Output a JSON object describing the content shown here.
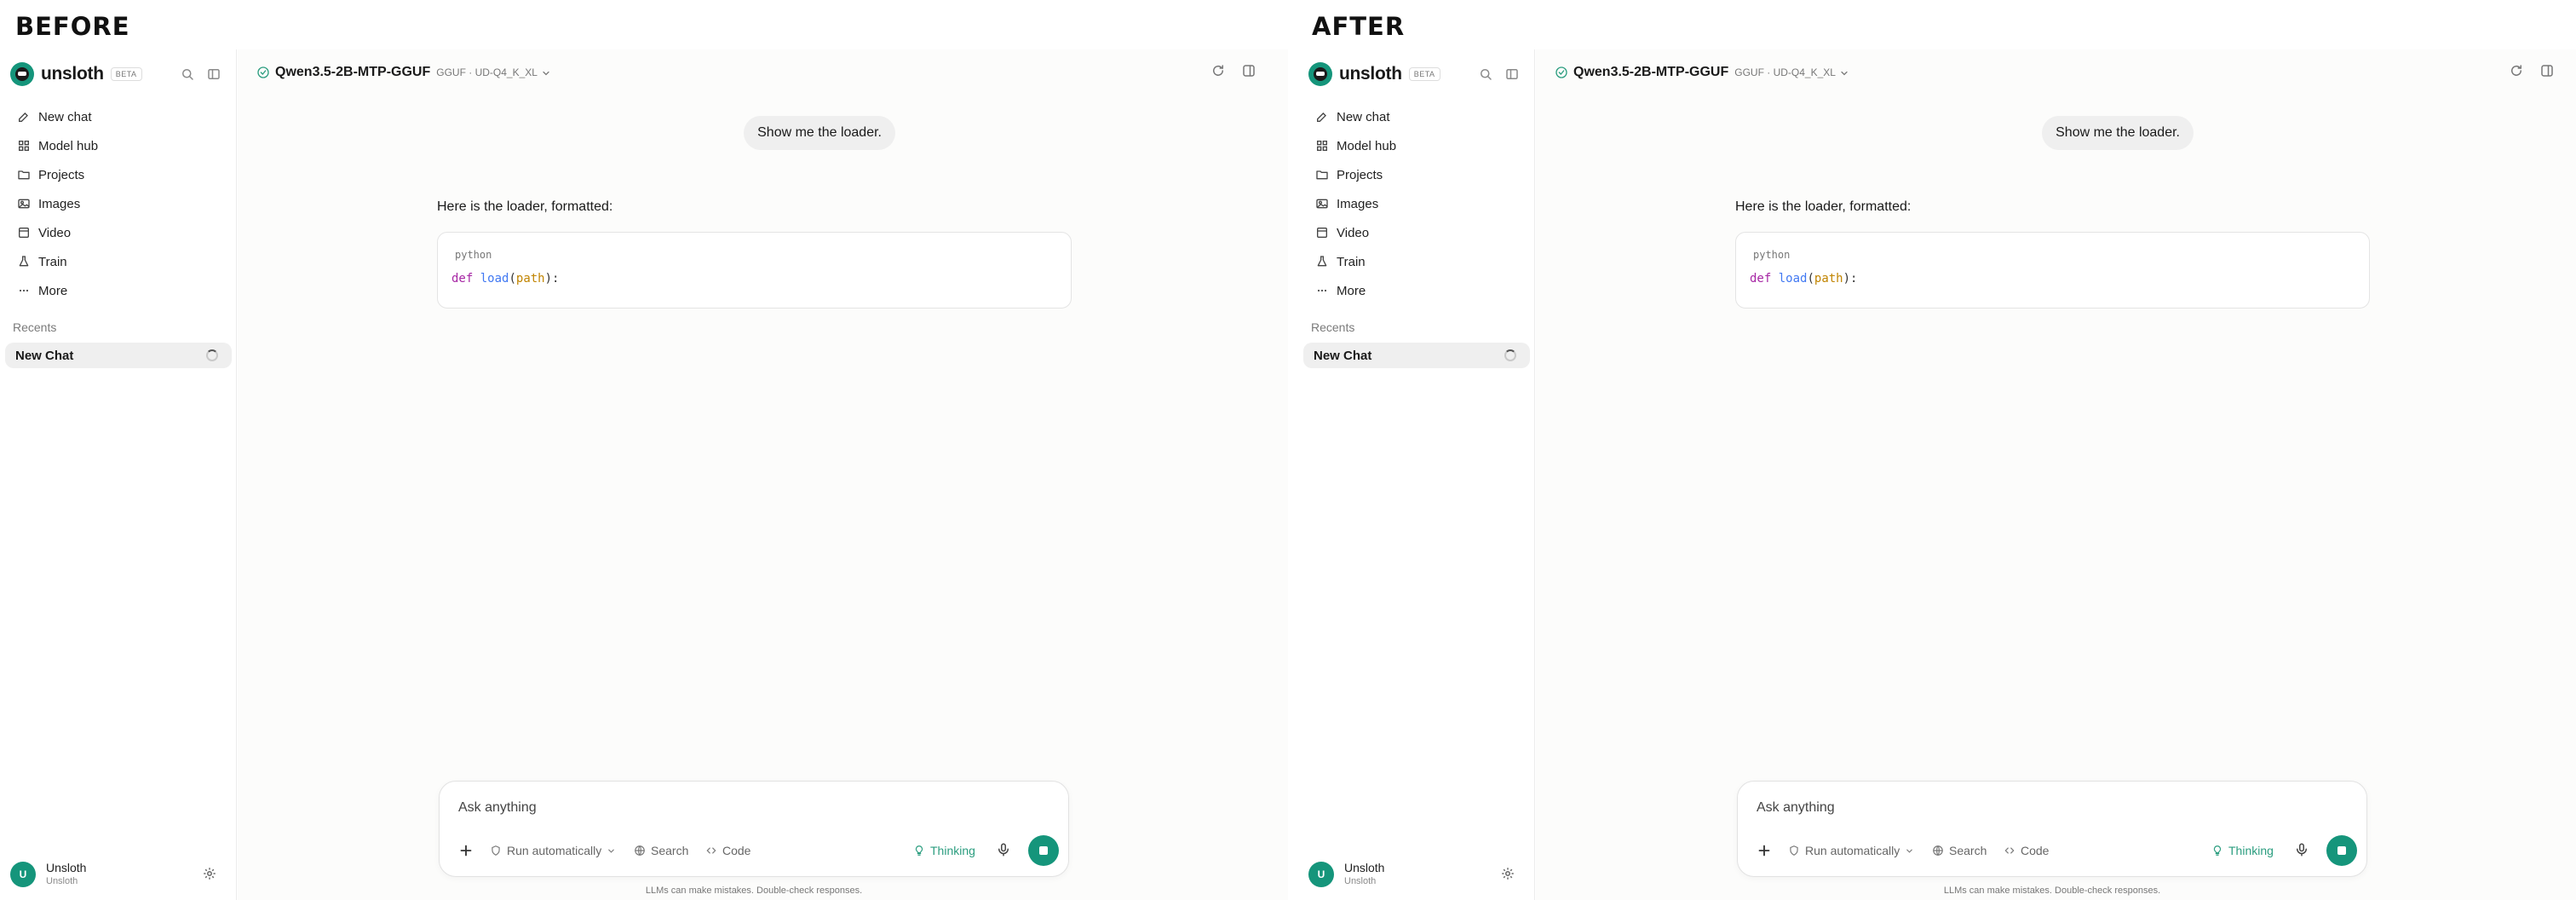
{
  "labels": {
    "before": "BEFORE",
    "after": "AFTER"
  },
  "app": {
    "brand_name": "unsloth",
    "brand_badge": "BETA"
  },
  "sidebar": {
    "nav": [
      {
        "label": "New chat",
        "icon": "edit-icon"
      },
      {
        "label": "Model hub",
        "icon": "grid-icon"
      },
      {
        "label": "Projects",
        "icon": "folder-icon"
      },
      {
        "label": "Images",
        "icon": "image-icon"
      },
      {
        "label": "Video",
        "icon": "video-icon"
      },
      {
        "label": "Train",
        "icon": "flask-icon"
      },
      {
        "label": "More",
        "icon": "ellipsis-icon"
      }
    ],
    "recents_label": "Recents",
    "recents": [
      {
        "label": "New Chat"
      }
    ]
  },
  "user": {
    "initial": "U",
    "name": "Unsloth",
    "subtitle": "Unsloth"
  },
  "header": {
    "model_name": "Qwen3.5-2B-MTP-GGUF",
    "model_detail": "GGUF · UD-Q4_K_XL"
  },
  "conversation": {
    "user_message": "Show me the loader.",
    "assistant_intro": "Here is the loader, formatted:",
    "code": {
      "language": "python",
      "keyword": "def",
      "function": "load",
      "open": "(",
      "param": "path",
      "close": "):"
    }
  },
  "composer": {
    "placeholder": "Ask anything",
    "run_mode": "Run automatically",
    "search_label": "Search",
    "code_label": "Code",
    "thinking_label": "Thinking",
    "disclaimer": "LLMs can make mistakes. Double-check responses."
  },
  "colors": {
    "accent": "#15957b",
    "thinking": "#2b9d7f"
  }
}
